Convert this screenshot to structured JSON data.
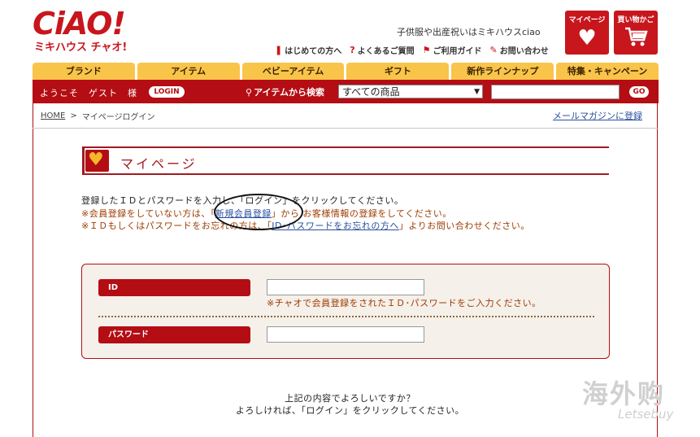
{
  "brand": {
    "logo": "CiAO!",
    "sub": "ミキハウス チャオ!"
  },
  "header": {
    "tagline": "子供服や出産祝いはミキハウスciao",
    "links": [
      {
        "icon": "book-icon",
        "glyph": "❚",
        "label": "はじめての方へ"
      },
      {
        "icon": "question-icon",
        "glyph": "?",
        "label": "よくあるご質問"
      },
      {
        "icon": "flag-icon",
        "glyph": "⚑",
        "label": "ご利用ガイド"
      },
      {
        "icon": "inquiry-icon",
        "glyph": "✎",
        "label": "お問い合わせ"
      }
    ],
    "mypage_label": "マイページ",
    "cart_label": "買い物かご"
  },
  "tabs": [
    "ブランド",
    "アイテム",
    "ベビーアイテム",
    "ギフト",
    "新作ラインナップ",
    "特集・キャンペーン"
  ],
  "searchbar": {
    "welcome": "ようこそ　ゲスト　様",
    "login_label": "LOGIN",
    "search_label": "アイテムから検索",
    "select_value": "すべての商品",
    "go_label": "GO"
  },
  "breadcrumb": {
    "home": "HOME",
    "sep": ">",
    "current": "マイページログイン"
  },
  "mailmag_link": "メールマガジンに登録",
  "section_title": "マイページ",
  "instructions": {
    "line1": "登録したＩＤとパスワードを入力し、「ログイン」をクリックしてください。",
    "line2_pre": "※会員登録をしていない方は、「",
    "line2_link": "新規会員登録",
    "line2_post": "」から お客様情報の登録をしてください。",
    "line3_pre": "※ＩＤもしくはパスワードをお忘れの方は、「",
    "line3_link": "ID･パスワードをお忘れの方へ",
    "line3_post": "」よりお問い合わせください。"
  },
  "form": {
    "id_label": "ID",
    "id_note": "※チャオで会員登録をされたＩＤ･パスワードをご入力ください。",
    "password_label": "パスワード",
    "id_value": "",
    "password_value": ""
  },
  "confirm": {
    "line1": "上記の内容でよろしいですか？",
    "line2": "よろしければ、「ログイン」をクリックしてください。"
  },
  "watermark": {
    "cn": "海外购",
    "en": "Letsebuy"
  },
  "colors": {
    "brand_red": "#c8161d",
    "bar_red": "#b40d14",
    "tab_yellow": "#f9c44a",
    "link_blue": "#2a4fa0"
  }
}
